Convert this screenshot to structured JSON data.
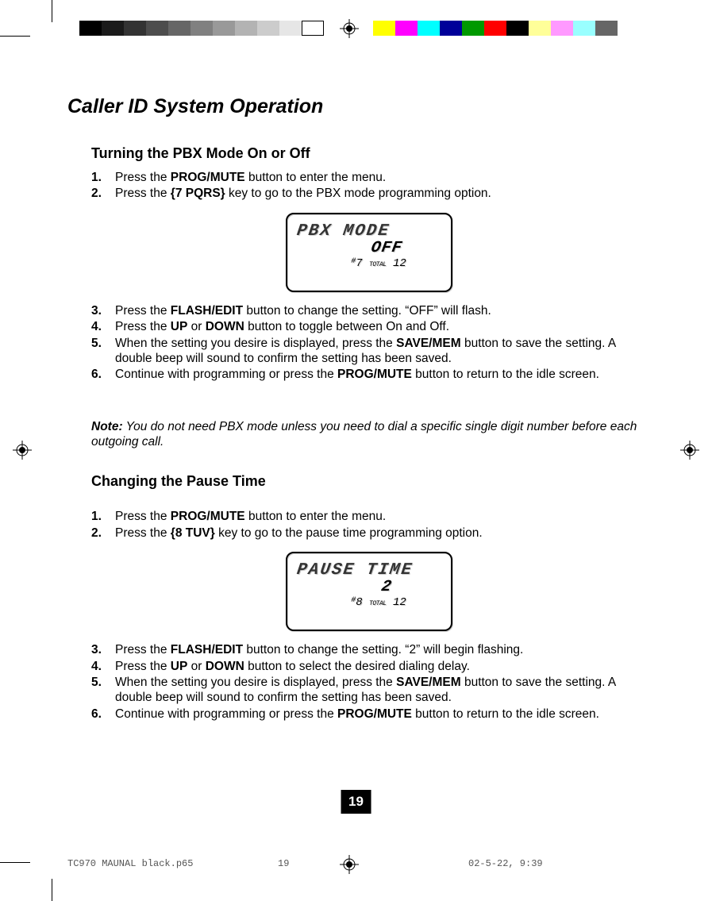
{
  "main_title": "Caller ID System Operation",
  "section1": {
    "title": "Turning the PBX Mode On or Off",
    "steps": [
      {
        "n": "1.",
        "prefix": "Press the ",
        "bold1": "PROG/MUTE",
        "mid": " button to enter the menu.",
        "bold2": "",
        "suffix": ""
      },
      {
        "n": "2.",
        "prefix": "Press the ",
        "bold1": "{7 PQRS}",
        "mid": " key to go to the PBX mode programming option.",
        "bold2": "",
        "suffix": ""
      }
    ],
    "lcd": {
      "line1": "PBX MODE",
      "line2": "OFF",
      "hashnum": "7",
      "total": "12"
    },
    "steps_after": [
      {
        "n": "3.",
        "prefix": "Press the ",
        "bold1": "FLASH/EDIT",
        "mid": " button to change the setting. “OFF” will flash.",
        "bold2": "",
        "suffix": ""
      },
      {
        "n": "4.",
        "prefix": "Press the  ",
        "bold1": "UP",
        "mid": "  or  ",
        "bold2": "DOWN",
        "suffix": "  button to toggle between On and Off."
      },
      {
        "n": "5.",
        "prefix": "When the setting you desire is displayed, press the ",
        "bold1": "SAVE/MEM",
        "mid": " button to save the setting. A double beep will sound to confirm the setting has been saved.",
        "bold2": "",
        "suffix": ""
      },
      {
        "n": "6.",
        "prefix": "Continue with programming or press the ",
        "bold1": "PROG/MUTE",
        "mid": " button to return to the idle screen.",
        "bold2": "",
        "suffix": ""
      }
    ]
  },
  "note": {
    "label": "Note:",
    "text": " You do not need PBX mode unless you need to dial a specific single digit number before each outgoing call."
  },
  "section2": {
    "title": "Changing the Pause Time",
    "steps": [
      {
        "n": "1.",
        "prefix": "Press the ",
        "bold1": "PROG/MUTE",
        "mid": " button to enter the menu.",
        "bold2": "",
        "suffix": ""
      },
      {
        "n": "2.",
        "prefix": "Press the ",
        "bold1": "{8 TUV}",
        "mid": " key to go to the pause time programming option.",
        "bold2": "",
        "suffix": ""
      }
    ],
    "lcd": {
      "line1": "PAUSE TIME",
      "line2": "2",
      "hashnum": "8",
      "total": "12"
    },
    "steps_after": [
      {
        "n": "3.",
        "prefix": "Press the ",
        "bold1": "FLASH/EDIT",
        "mid": " button to change the setting. “2” will begin flashing.",
        "bold2": "",
        "suffix": ""
      },
      {
        "n": "4.",
        "prefix": "Press the ",
        "bold1": "UP",
        "mid": " or ",
        "bold2": "DOWN",
        "suffix": " button to select the desired dialing delay."
      },
      {
        "n": "5.",
        "prefix": "When the setting you desire is displayed, press the ",
        "bold1": "SAVE/MEM",
        "mid": " button to save the setting. A double beep will sound to confirm the setting has been saved.",
        "bold2": "",
        "suffix": ""
      },
      {
        "n": "6.",
        "prefix": "Continue with programming or press the ",
        "bold1": "PROG/MUTE",
        "mid": " button to return to the idle screen.",
        "bold2": "",
        "suffix": ""
      }
    ]
  },
  "page_number": "19",
  "footer": {
    "file": "TC970 MAUNAL black.p65",
    "page": "19",
    "date": "02-5-22, 9:39"
  }
}
